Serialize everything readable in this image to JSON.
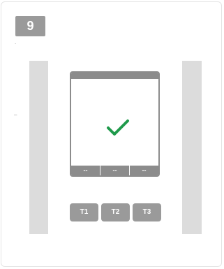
{
  "step": {
    "number": "9"
  },
  "marks": {
    "top": ".",
    "left": "–"
  },
  "display": {
    "status_icon": "checkmark-icon",
    "status_color": "#1f9a4b",
    "slots": [
      "--",
      "--",
      "--"
    ]
  },
  "buttons": [
    {
      "label": "T1"
    },
    {
      "label": "T2"
    },
    {
      "label": "T3"
    }
  ]
}
